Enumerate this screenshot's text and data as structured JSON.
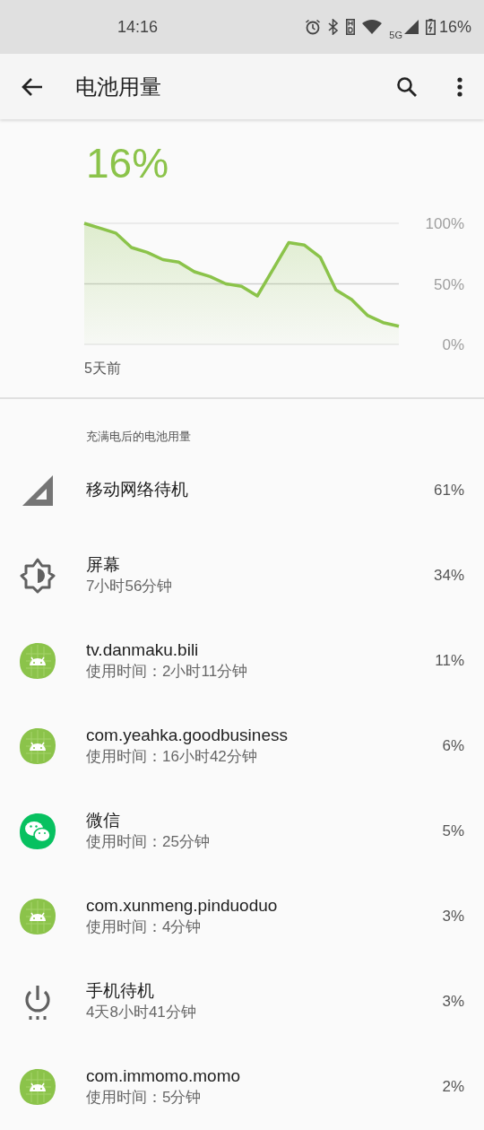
{
  "status_bar": {
    "time": "14:16",
    "network": "5G",
    "battery": "16%"
  },
  "app_bar": {
    "title": "电池用量"
  },
  "summary": {
    "level_text": "16%",
    "chart_data": {
      "type": "area",
      "xlabel": "5天前",
      "series": [
        {
          "color": "#8bc34a",
          "values": [
            100,
            96,
            92,
            80,
            76,
            70,
            68,
            60,
            56,
            50,
            48,
            40,
            62,
            84,
            82,
            72,
            45,
            37,
            24,
            18,
            15
          ]
        }
      ],
      "ylim": [
        0,
        100
      ],
      "yticks": [
        {
          "value": 100,
          "label": "100%"
        },
        {
          "value": 50,
          "label": "50%"
        },
        {
          "value": 0,
          "label": "0%"
        }
      ]
    }
  },
  "section_title": "充满电后的电池用量",
  "items": [
    {
      "kind": "signal",
      "title": "移动网络待机",
      "percent": "61%"
    },
    {
      "kind": "brightness",
      "title": "屏幕",
      "subtitle": "7小时56分钟",
      "percent": "34%"
    },
    {
      "kind": "android",
      "title": "tv.danmaku.bili",
      "subtitle": "使用时间：2小时11分钟",
      "percent": "11%"
    },
    {
      "kind": "android",
      "title": "com.yeahka.goodbusiness",
      "subtitle": "使用时间：16小时42分钟",
      "percent": "6%"
    },
    {
      "kind": "chat",
      "title": "微信",
      "subtitle": "使用时间：25分钟",
      "percent": "5%"
    },
    {
      "kind": "android",
      "title": "com.xunmeng.pinduoduo",
      "subtitle": "使用时间：4分钟",
      "percent": "3%"
    },
    {
      "kind": "power",
      "title": "手机待机",
      "subtitle": "4天8小时41分钟",
      "percent": "3%"
    },
    {
      "kind": "android",
      "title": "com.immomo.momo",
      "subtitle": "使用时间：5分钟",
      "percent": "2%"
    }
  ]
}
